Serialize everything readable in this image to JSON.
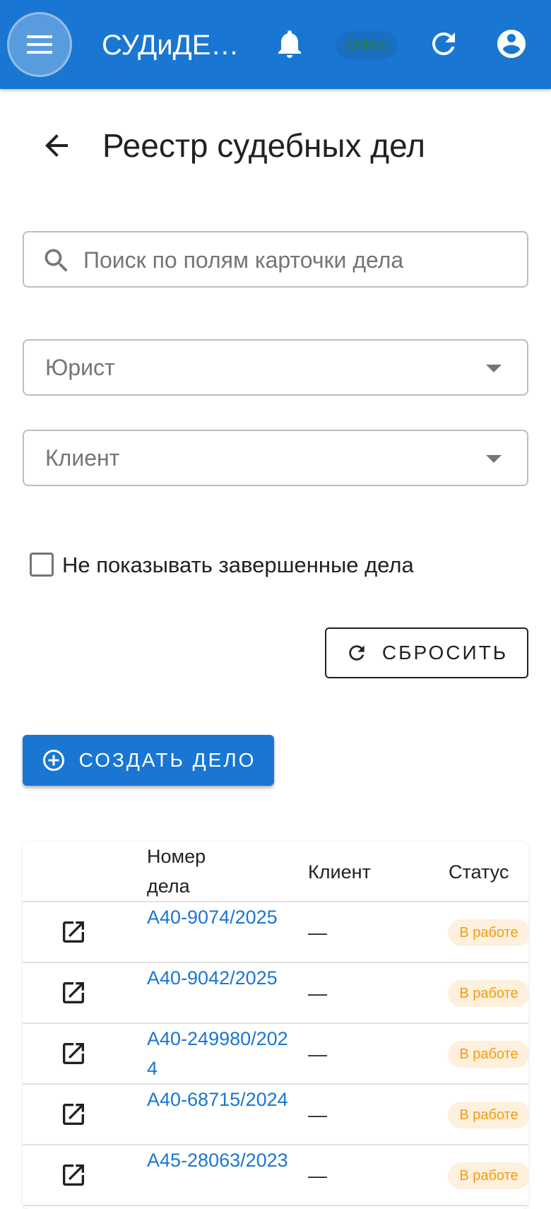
{
  "appbar": {
    "title": "СУДиДЕЛО",
    "online_badge": "Online"
  },
  "page": {
    "title": "Реестр судебных дел"
  },
  "filters": {
    "search_placeholder": "Поиск по полям карточки дела",
    "lawyer_label": "Юрист",
    "client_label": "Клиент",
    "hide_completed_label": "Не показывать завершенные дела",
    "hide_completed_checked": false,
    "reset_label": "СБРОСИТЬ"
  },
  "actions": {
    "create_label": "СОЗДАТЬ ДЕЛО"
  },
  "colors": {
    "primary": "#1976d2",
    "status_text": "#f39c12",
    "status_bg": "#fdf0dc"
  },
  "table": {
    "headers": {
      "number": "Номер дела",
      "client": "Клиент",
      "status": "Статус"
    },
    "rows": [
      {
        "number": "А40-9074/2025",
        "client": "—",
        "status": "В работе"
      },
      {
        "number": "А40-9042/2025",
        "client": "—",
        "status": "В работе"
      },
      {
        "number": "А40-249980/2024",
        "client": "—",
        "status": "В работе"
      },
      {
        "number": "А40-68715/2024",
        "client": "—",
        "status": "В работе"
      },
      {
        "number": "А45-28063/2023",
        "client": "—",
        "status": "В работе"
      }
    ]
  }
}
